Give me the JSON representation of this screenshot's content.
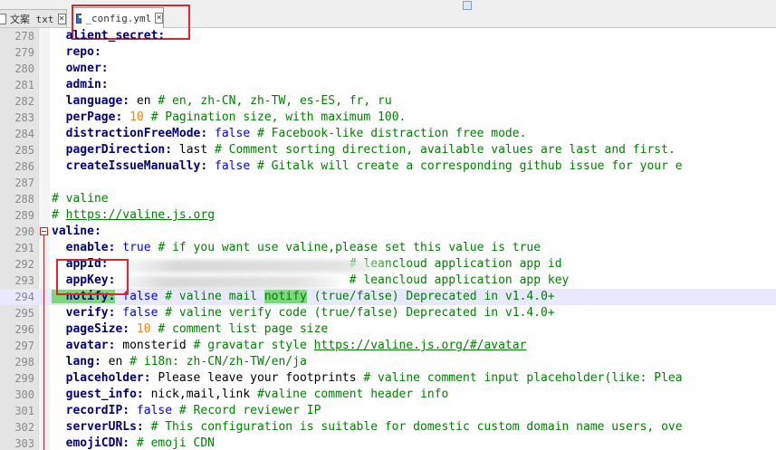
{
  "tabs": [
    {
      "label": "文案 txt",
      "active": false
    },
    {
      "label": "_config.yml",
      "active": true
    }
  ],
  "editor": {
    "lines": [
      {
        "num": "278",
        "tokens": [
          {
            "t": "  alient_secret:",
            "c": "k"
          }
        ]
      },
      {
        "num": "279",
        "tokens": [
          {
            "t": "  repo:",
            "c": "k"
          }
        ]
      },
      {
        "num": "280",
        "tokens": [
          {
            "t": "  owner:",
            "c": "k"
          }
        ]
      },
      {
        "num": "281",
        "tokens": [
          {
            "t": "  admin:",
            "c": "k"
          }
        ]
      },
      {
        "num": "282",
        "tokens": [
          {
            "t": "  language:",
            "c": "k"
          },
          {
            "t": " en ",
            "c": "s"
          },
          {
            "t": "# en, zh-CN, zh-TW, es-ES, fr, ru",
            "c": "c"
          }
        ]
      },
      {
        "num": "283",
        "tokens": [
          {
            "t": "  perPage:",
            "c": "k"
          },
          {
            "t": " ",
            "c": "s"
          },
          {
            "t": "10",
            "c": "n"
          },
          {
            "t": " # Pagination size, with maximum 100.",
            "c": "c"
          }
        ]
      },
      {
        "num": "284",
        "tokens": [
          {
            "t": "  distractionFreeMode:",
            "c": "k"
          },
          {
            "t": " ",
            "c": "s"
          },
          {
            "t": "false",
            "c": "v"
          },
          {
            "t": " # Facebook-like distraction free mode.",
            "c": "c"
          }
        ]
      },
      {
        "num": "285",
        "tokens": [
          {
            "t": "  pagerDirection:",
            "c": "k"
          },
          {
            "t": " last ",
            "c": "s"
          },
          {
            "t": "# Comment sorting direction, available values are last and first.",
            "c": "c"
          }
        ]
      },
      {
        "num": "286",
        "tokens": [
          {
            "t": "  createIssueManually:",
            "c": "k"
          },
          {
            "t": " ",
            "c": "s"
          },
          {
            "t": "false",
            "c": "v"
          },
          {
            "t": " # Gitalk will create a corresponding github issue for your e",
            "c": "c"
          }
        ]
      },
      {
        "num": "287",
        "tokens": []
      },
      {
        "num": "288",
        "tokens": [
          {
            "t": "# valine",
            "c": "c"
          }
        ]
      },
      {
        "num": "289",
        "tokens": [
          {
            "t": "# ",
            "c": "c"
          },
          {
            "t": "https://valine.js.org",
            "c": "c",
            "link": true
          }
        ]
      },
      {
        "num": "290",
        "tokens": [
          {
            "t": "valine:",
            "c": "k"
          }
        ],
        "fold": true
      },
      {
        "num": "291",
        "tokens": [
          {
            "t": "  enable:",
            "c": "k"
          },
          {
            "t": " ",
            "c": "s"
          },
          {
            "t": "true",
            "c": "v"
          },
          {
            "t": " # if you want use valine,please set this value is true",
            "c": "c"
          }
        ]
      },
      {
        "num": "292",
        "tokens": [
          {
            "t": "  appId:",
            "c": "k"
          },
          {
            "t": "                                  ",
            "c": "s"
          },
          {
            "t": "# leancloud application app id",
            "c": "c"
          }
        ]
      },
      {
        "num": "293",
        "tokens": [
          {
            "t": "  appKey:",
            "c": "k"
          },
          {
            "t": "                                 ",
            "c": "s"
          },
          {
            "t": "# leancloud application app key",
            "c": "c"
          }
        ]
      },
      {
        "num": "294",
        "tokens": [
          {
            "t": "  notify:",
            "c": "k",
            "mark": true
          },
          {
            "t": " ",
            "c": "s"
          },
          {
            "t": "false",
            "c": "v"
          },
          {
            "t": " # valine mail ",
            "c": "c"
          },
          {
            "t": "notify",
            "c": "c",
            "mark": true
          },
          {
            "t": " (true/false) Deprecated in v1.4.0+",
            "c": "c"
          }
        ],
        "current": true
      },
      {
        "num": "295",
        "tokens": [
          {
            "t": "  verify:",
            "c": "k"
          },
          {
            "t": " ",
            "c": "s"
          },
          {
            "t": "false",
            "c": "v"
          },
          {
            "t": " # valine verify code (true/false) Deprecated in v1.4.0+",
            "c": "c"
          }
        ]
      },
      {
        "num": "296",
        "tokens": [
          {
            "t": "  pageSize:",
            "c": "k"
          },
          {
            "t": " ",
            "c": "s"
          },
          {
            "t": "10",
            "c": "n"
          },
          {
            "t": " # comment list page size",
            "c": "c"
          }
        ]
      },
      {
        "num": "297",
        "tokens": [
          {
            "t": "  avatar:",
            "c": "k"
          },
          {
            "t": " monsterid ",
            "c": "s"
          },
          {
            "t": "# gravatar style ",
            "c": "c"
          },
          {
            "t": "https://valine.js.org/#/avatar",
            "c": "c",
            "link": true
          }
        ]
      },
      {
        "num": "298",
        "tokens": [
          {
            "t": "  lang:",
            "c": "k"
          },
          {
            "t": " en ",
            "c": "s"
          },
          {
            "t": "# i18n: zh-CN/zh-TW/en/ja",
            "c": "c"
          }
        ]
      },
      {
        "num": "299",
        "tokens": [
          {
            "t": "  placeholder:",
            "c": "k"
          },
          {
            "t": " Please leave your footprints ",
            "c": "s"
          },
          {
            "t": "# valine comment input placeholder(like: Plea",
            "c": "c"
          }
        ]
      },
      {
        "num": "300",
        "tokens": [
          {
            "t": "  guest_info:",
            "c": "k"
          },
          {
            "t": " nick,mail,link ",
            "c": "s"
          },
          {
            "t": "#valine comment header info",
            "c": "c"
          }
        ]
      },
      {
        "num": "301",
        "tokens": [
          {
            "t": "  recordIP:",
            "c": "k"
          },
          {
            "t": " ",
            "c": "s"
          },
          {
            "t": "false",
            "c": "v"
          },
          {
            "t": " # Record reviewer IP",
            "c": "c"
          }
        ]
      },
      {
        "num": "302",
        "tokens": [
          {
            "t": "  serverURLs:",
            "c": "k"
          },
          {
            "t": " # This configuration is suitable for domestic custom domain name users, ove",
            "c": "c"
          }
        ]
      },
      {
        "num": "303",
        "tokens": [
          {
            "t": "  emojiCDN:",
            "c": "k"
          },
          {
            "t": " # emoji CDN",
            "c": "c"
          }
        ]
      }
    ]
  },
  "colors": {
    "highlight_box": "#e0262a",
    "keyword": "#000080",
    "value": "#0000ff",
    "number": "#ff8000",
    "comment": "#008000",
    "match_mark": "#7dd87d",
    "current_line": "#e8e8ff"
  },
  "icons": {
    "inactive_tab": "file-icon",
    "active_tab": "save-icon",
    "close": "close-icon",
    "fold": "fold-minus-icon"
  }
}
